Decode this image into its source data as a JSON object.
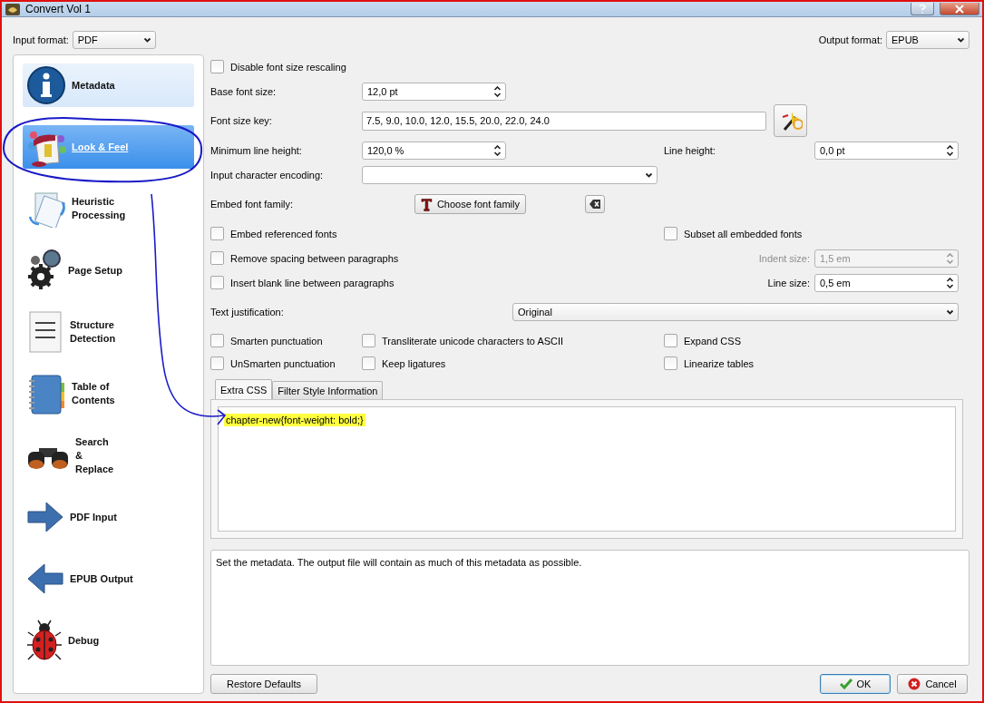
{
  "window": {
    "title": "Convert Vol 1"
  },
  "input_format": {
    "label": "Input format:",
    "value": "PDF"
  },
  "output_format": {
    "label": "Output format:",
    "value": "EPUB"
  },
  "sidebar": {
    "items": [
      {
        "label": "Metadata",
        "selected": false,
        "hover": true
      },
      {
        "label": "Look & Feel",
        "selected": true,
        "hover": false
      },
      {
        "label": "Heuristic Processing",
        "selected": false,
        "hover": false
      },
      {
        "label": "Page Setup",
        "selected": false,
        "hover": false
      },
      {
        "label": "Structure Detection",
        "selected": false,
        "hover": false
      },
      {
        "label": "Table of Contents",
        "selected": false,
        "hover": false
      },
      {
        "label": "Search\n&\nReplace",
        "selected": false,
        "hover": false
      },
      {
        "label": "PDF Input",
        "selected": false,
        "hover": false
      },
      {
        "label": "EPUB Output",
        "selected": false,
        "hover": false
      },
      {
        "label": "Debug",
        "selected": false,
        "hover": false
      }
    ]
  },
  "form": {
    "disable_rescaling": {
      "label": "Disable font size rescaling",
      "checked": false
    },
    "base_font_size": {
      "label": "Base font size:",
      "value": "12,0 pt"
    },
    "font_size_key": {
      "label": "Font size key:",
      "value": "7.5, 9.0, 10.0, 12.0, 15.5, 20.0, 22.0, 24.0"
    },
    "min_line_height": {
      "label": "Minimum line height:",
      "value": "120,0 %"
    },
    "line_height": {
      "label": "Line height:",
      "value": "0,0 pt"
    },
    "input_encoding": {
      "label": "Input character encoding:"
    },
    "embed_font_family": {
      "label": "Embed font family:",
      "button": "Choose font family"
    },
    "embed_referenced": {
      "label": "Embed referenced fonts",
      "checked": false
    },
    "subset_fonts": {
      "label": "Subset all embedded fonts",
      "checked": false
    },
    "remove_spacing": {
      "label": "Remove spacing between paragraphs",
      "checked": false
    },
    "indent_size": {
      "label": "Indent size:",
      "value": "1,5 em",
      "disabled": true
    },
    "insert_blank": {
      "label": "Insert blank line between paragraphs",
      "checked": false
    },
    "line_size": {
      "label": "Line size:",
      "value": "0,5 em",
      "disabled": false
    },
    "text_justification": {
      "label": "Text justification:",
      "value": "Original"
    },
    "smarten": {
      "label": "Smarten punctuation",
      "checked": false
    },
    "transliterate": {
      "label": "Transliterate unicode characters to ASCII",
      "checked": false
    },
    "expand_css": {
      "label": "Expand CSS",
      "checked": false
    },
    "unsmarten": {
      "label": "UnSmarten punctuation",
      "checked": false
    },
    "keep_ligatures": {
      "label": "Keep ligatures",
      "checked": false
    },
    "linearize": {
      "label": "Linearize tables",
      "checked": false
    }
  },
  "tabs": [
    {
      "label": "Extra CSS",
      "selected": true
    },
    {
      "label": "Filter Style Information",
      "selected": false
    }
  ],
  "extra_css": {
    "text": "chapter-new{font-weight: bold;}",
    "highlighted": true
  },
  "description": "Set the metadata. The output file will contain as much of this metadata as possible.",
  "buttons": {
    "restore": "Restore Defaults",
    "ok": "OK",
    "cancel": "Cancel"
  }
}
